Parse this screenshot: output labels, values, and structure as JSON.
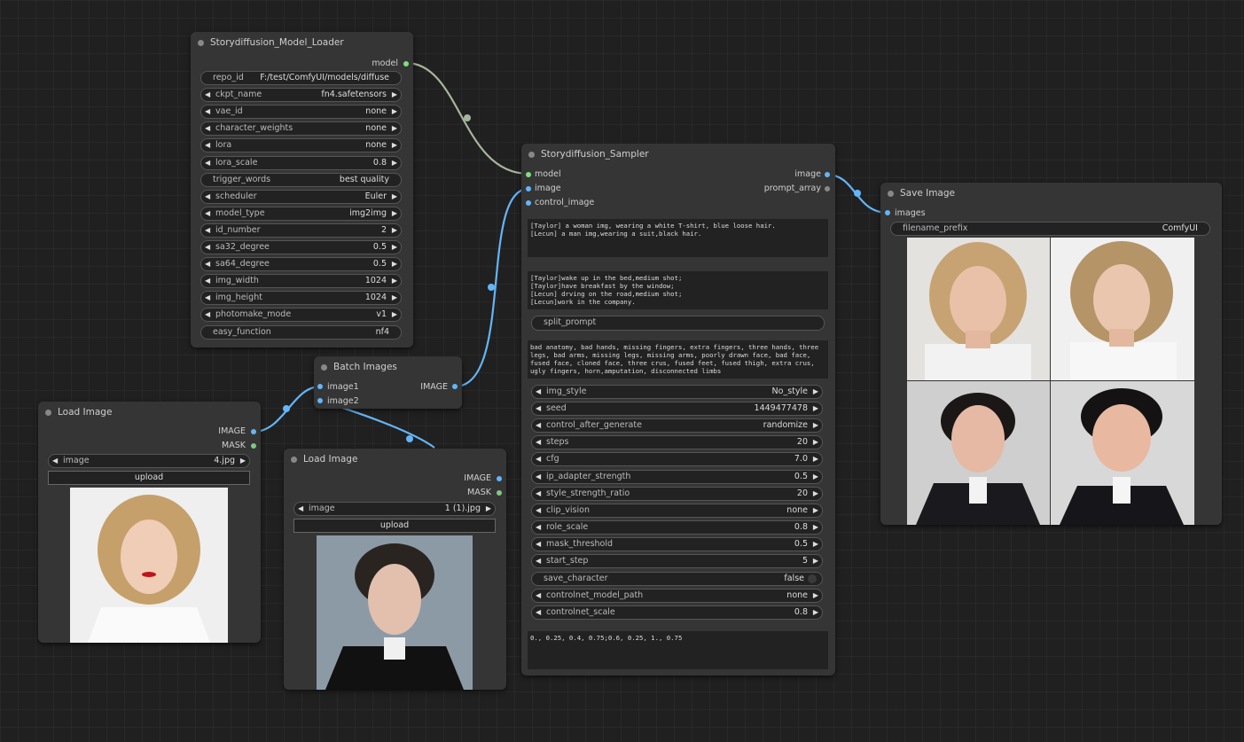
{
  "model_loader": {
    "title": "Storydiffusion_Model_Loader",
    "output": "model",
    "widgets": [
      {
        "name": "repo_id",
        "value": "F:/test/ComfyUI/models/diffuse",
        "combo": false
      },
      {
        "name": "ckpt_name",
        "value": "fn4.safetensors",
        "combo": true
      },
      {
        "name": "vae_id",
        "value": "none",
        "combo": true
      },
      {
        "name": "character_weights",
        "value": "none",
        "combo": true
      },
      {
        "name": "lora",
        "value": "none",
        "combo": true
      },
      {
        "name": "lora_scale",
        "value": "0.8",
        "combo": true
      },
      {
        "name": "trigger_words",
        "value": "best quality",
        "combo": false
      },
      {
        "name": "scheduler",
        "value": "Euler",
        "combo": true
      },
      {
        "name": "model_type",
        "value": "img2img",
        "combo": true
      },
      {
        "name": "id_number",
        "value": "2",
        "combo": true
      },
      {
        "name": "sa32_degree",
        "value": "0.5",
        "combo": true
      },
      {
        "name": "sa64_degree",
        "value": "0.5",
        "combo": true
      },
      {
        "name": "img_width",
        "value": "1024",
        "combo": true
      },
      {
        "name": "img_height",
        "value": "1024",
        "combo": true
      },
      {
        "name": "photomake_mode",
        "value": "v1",
        "combo": true
      },
      {
        "name": "easy_function",
        "value": "nf4",
        "combo": false
      }
    ]
  },
  "sampler": {
    "title": "Storydiffusion_Sampler",
    "inputs": [
      "model",
      "image",
      "control_image"
    ],
    "outputs": [
      "image",
      "prompt_array"
    ],
    "character_prompt": "[Taylor] a woman img, wearing a white T-shirt, blue loose hair.\n[Lecun] a man img,wearing a suit,black hair.",
    "scene_prompt": "[Taylor]wake up in the bed,medium shot;\n[Taylor]have breakfast by the window;\n[Lecun] drving on the road,medium shot;\n[Lecun]work in the company.",
    "split_prompt_placeholder": "split_prompt",
    "negative_prompt": "bad anatomy, bad hands, missing fingers, extra fingers, three hands, three legs, bad arms, missing legs, missing arms, poorly drawn face, bad face, fused face, cloned face, three crus, fused feet, fused thigh, extra crus, ugly fingers, horn,amputation, disconnected limbs",
    "widgets": [
      {
        "name": "img_style",
        "value": "No_style"
      },
      {
        "name": "seed",
        "value": "1449477478"
      },
      {
        "name": "control_after_generate",
        "value": "randomize"
      },
      {
        "name": "steps",
        "value": "20"
      },
      {
        "name": "cfg",
        "value": "7.0"
      },
      {
        "name": "ip_adapter_strength",
        "value": "0.5"
      },
      {
        "name": "style_strength_ratio",
        "value": "20"
      },
      {
        "name": "clip_vision",
        "value": "none"
      },
      {
        "name": "role_scale",
        "value": "0.8"
      },
      {
        "name": "mask_threshold",
        "value": "0.5"
      },
      {
        "name": "start_step",
        "value": "5"
      }
    ],
    "save_character": {
      "name": "save_character",
      "value": "false"
    },
    "widgets2": [
      {
        "name": "controlnet_model_path",
        "value": "none"
      },
      {
        "name": "controlnet_scale",
        "value": "0.8"
      }
    ],
    "bottom_text": "0., 0.25, 0.4, 0.75;0.6, 0.25, 1., 0.75"
  },
  "save_image": {
    "title": "Save Image",
    "input": "images",
    "filename_prefix": {
      "name": "filename_prefix",
      "value": "ComfyUI"
    }
  },
  "batch_images": {
    "title": "Batch Images",
    "inputs": [
      "image1",
      "image2"
    ],
    "output": "IMAGE"
  },
  "load_image_1": {
    "title": "Load Image",
    "outputs": [
      "IMAGE",
      "MASK"
    ],
    "image": {
      "name": "image",
      "value": "4.jpg"
    },
    "upload": "upload"
  },
  "load_image_2": {
    "title": "Load Image",
    "outputs": [
      "IMAGE",
      "MASK"
    ],
    "image": {
      "name": "image",
      "value": "1 (1).jpg"
    },
    "upload": "upload"
  },
  "colors": {
    "model_link": "#a8b59c",
    "image_link": "#64b5f6",
    "model_slot": "#7ee07e",
    "image_slot": "#64b5f6",
    "mask_slot": "#81c784"
  }
}
